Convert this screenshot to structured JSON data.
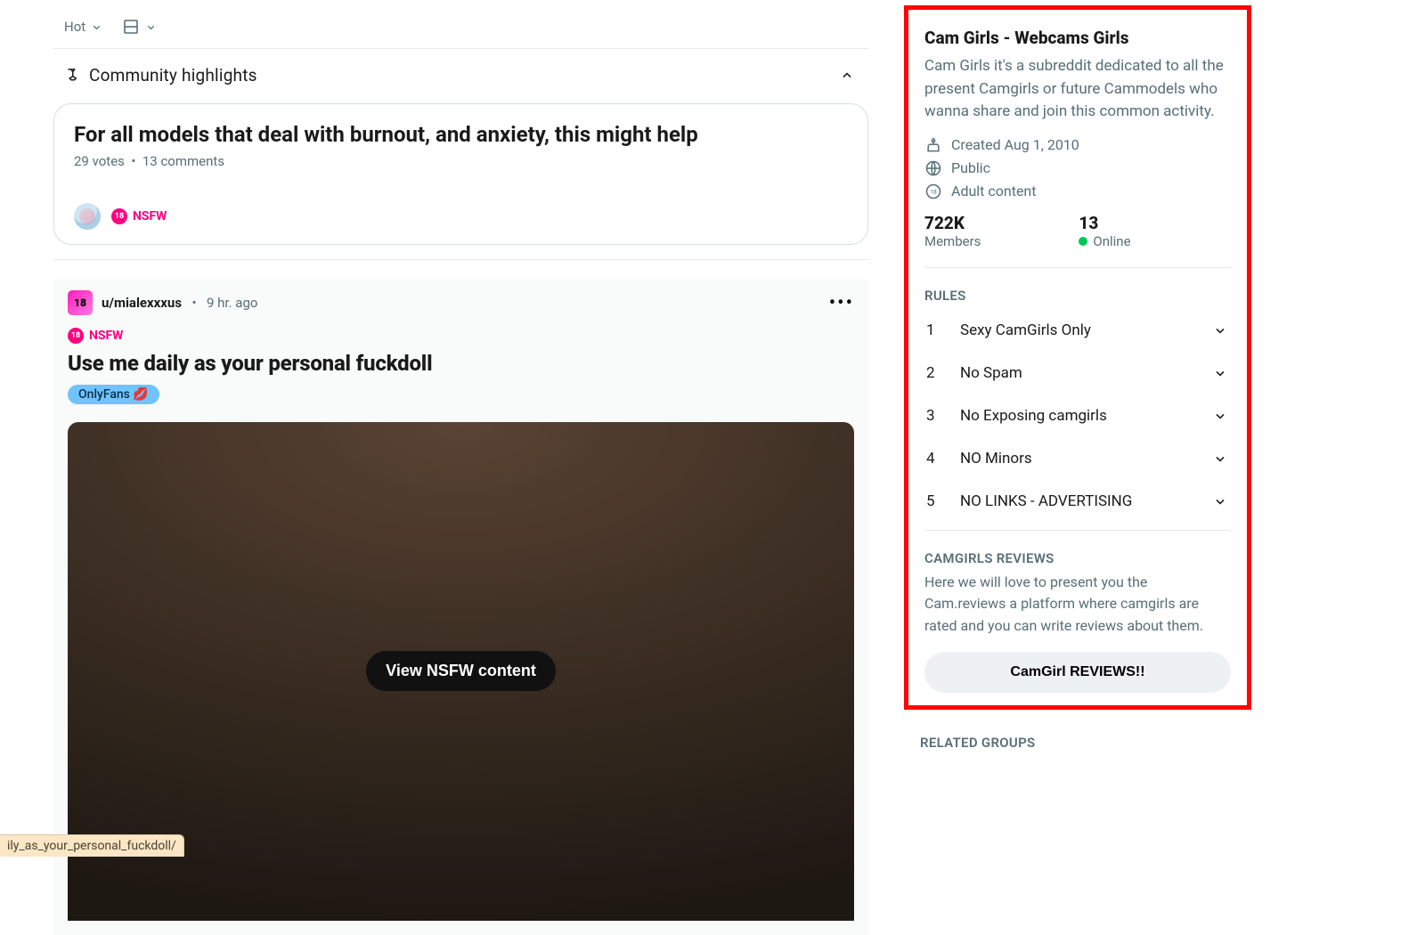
{
  "sort": {
    "label": "Hot"
  },
  "highlights": {
    "header": "Community highlights",
    "card": {
      "title": "For all models that deal with burnout, and anxiety, this might help",
      "votes": "29 votes",
      "comments": "13 comments",
      "nsfw": "NSFW"
    }
  },
  "post": {
    "avatar_badge": "18",
    "author": "u/mialexxxus",
    "timestamp": "9 hr. ago",
    "nsfw": "NSFW",
    "title": "Use me daily as your personal fuckdoll",
    "flair": "OnlyFans 💋",
    "media_button": "View NSFW content"
  },
  "sidebar": {
    "title": "Cam Girls - Webcams Girls",
    "description": "Cam Girls it's a subreddit dedicated to all the present Camgirls or future Cammodels who wanna share and join this common activity.",
    "created": "Created Aug 1, 2010",
    "visibility": "Public",
    "adult": "Adult content",
    "stats": {
      "members_num": "722K",
      "members_lbl": "Members",
      "online_num": "13",
      "online_lbl": "Online"
    },
    "rules_header": "RULES",
    "rules": [
      {
        "n": "1",
        "text": "Sexy CamGirls Only"
      },
      {
        "n": "2",
        "text": "No Spam"
      },
      {
        "n": "3",
        "text": "No Exposing camgirls"
      },
      {
        "n": "4",
        "text": "NO Minors"
      },
      {
        "n": "5",
        "text": "NO LINKS - ADVERTISING"
      }
    ],
    "reviews_header": "CAMGIRLS REVIEWS",
    "reviews_text": "Here we will love to present you the Cam.reviews a platform where camgirls are rated and you can write reviews about them.",
    "reviews_btn": "CamGirl REVIEWS!!",
    "related_header": "RELATED GROUPS"
  },
  "url_fragment": "ily_as_your_personal_fuckdoll/"
}
